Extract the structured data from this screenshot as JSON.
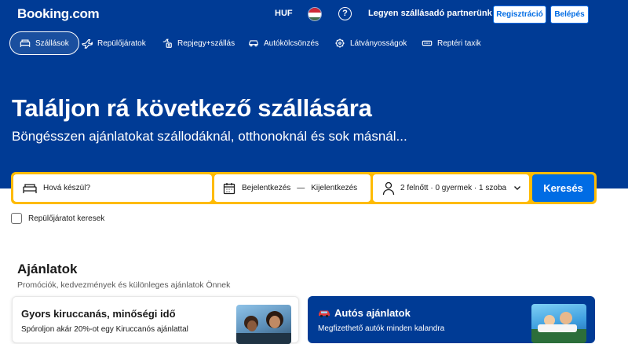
{
  "brand": {
    "logo": "Booking.com"
  },
  "header": {
    "currency": "HUF",
    "partner_link": "Legyen szállásadó partnerünk",
    "register_label": "Regisztráció",
    "login_label": "Belépés"
  },
  "nav": {
    "items": [
      {
        "label": "Szállások",
        "icon": "bed-icon"
      },
      {
        "label": "Repülőjáratok",
        "icon": "plane-icon"
      },
      {
        "label": "Repjegy+szállás",
        "icon": "plane-hotel-icon"
      },
      {
        "label": "Autókölcsönzés",
        "icon": "car-icon"
      },
      {
        "label": "Látványosságok",
        "icon": "attractions-icon"
      },
      {
        "label": "Reptéri taxik",
        "icon": "taxi-icon"
      }
    ]
  },
  "hero": {
    "title": "Találjon rá következő szállására",
    "subtitle": "Böngésszen ajánlatokat szállodáknál, otthonoknál és sok másnál..."
  },
  "search": {
    "destination_placeholder": "Hová készül?",
    "checkin": "Bejelentkezés",
    "dash": "—",
    "checkout": "Kijelentkezés",
    "guests": "2 felnőtt · 0 gyermek · 1 szoba",
    "button_label": "Keresés",
    "flight_checkbox_label": "Repülőjáratot keresek"
  },
  "offers": {
    "title": "Ajánlatok",
    "subtitle": "Promóciók, kedvezmények és különleges ajánlatok Önnek",
    "cards": [
      {
        "title": "Gyors kiruccanás, minőségi idő",
        "text": "Spóroljon akár 20%-ot egy Kiruccanós ajánlattal"
      },
      {
        "title": "Autós ajánlatok",
        "text": "Megfizethető autók minden kalandra"
      }
    ]
  },
  "colors": {
    "brand_blue": "#003b95",
    "accent_blue": "#006ce4",
    "search_yellow": "#febb02"
  }
}
